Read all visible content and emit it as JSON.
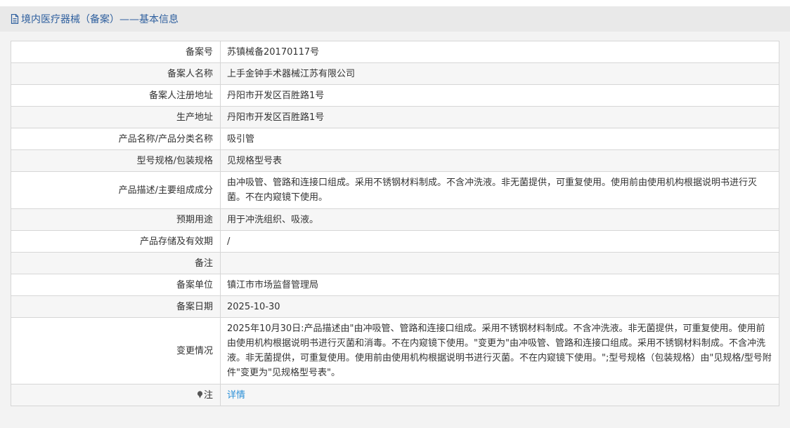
{
  "header": {
    "title": "境内医疗器械（备案）——基本信息",
    "icon": "document-icon",
    "title_color": "#2e5f9e"
  },
  "rows": [
    {
      "label": "备案号",
      "value": "苏镇械备20170117号"
    },
    {
      "label": "备案人名称",
      "value": "上手金钟手术器械江苏有限公司"
    },
    {
      "label": "备案人注册地址",
      "value": "丹阳市开发区百胜路1号"
    },
    {
      "label": "生产地址",
      "value": "丹阳市开发区百胜路1号"
    },
    {
      "label": "产品名称/产品分类名称",
      "value": "吸引管"
    },
    {
      "label": "型号规格/包装规格",
      "value": "见规格型号表"
    },
    {
      "label": "产品描述/主要组成成分",
      "value": "由冲吸管、管路和连接口组成。采用不锈钢材料制成。不含冲洗液。非无菌提供，可重复使用。使用前由使用机构根据说明书进行灭菌。不在内窥镜下使用。"
    },
    {
      "label": "预期用途",
      "value": "用于冲洗组织、吸液。"
    },
    {
      "label": "产品存储及有效期",
      "value": "/"
    },
    {
      "label": "备注",
      "value": ""
    },
    {
      "label": "备案单位",
      "value": "镇江市市场监督管理局"
    },
    {
      "label": "备案日期",
      "value": "2025-10-30"
    },
    {
      "label": "变更情况",
      "value": "2025年10月30日:产品描述由\"由冲吸管、管路和连接口组成。采用不锈钢材料制成。不含冲洗液。非无菌提供，可重复使用。使用前由使用机构根据说明书进行灭菌和消毒。不在内窥镜下使用。\"变更为\"由冲吸管、管路和连接口组成。采用不锈钢材料制成。不含冲洗液。非无菌提供，可重复使用。使用前由使用机构根据说明书进行灭菌。不在内窥镜下使用。\";型号规格（包装规格）由\"见规格/型号附件\"变更为\"见规格型号表\"。"
    },
    {
      "label": "注",
      "value": "详情",
      "icon": "pin-icon"
    }
  ],
  "colors": {
    "link": "#2a8fd7",
    "border": "#d6d6d6",
    "header_bg": "#e9e9e9"
  }
}
